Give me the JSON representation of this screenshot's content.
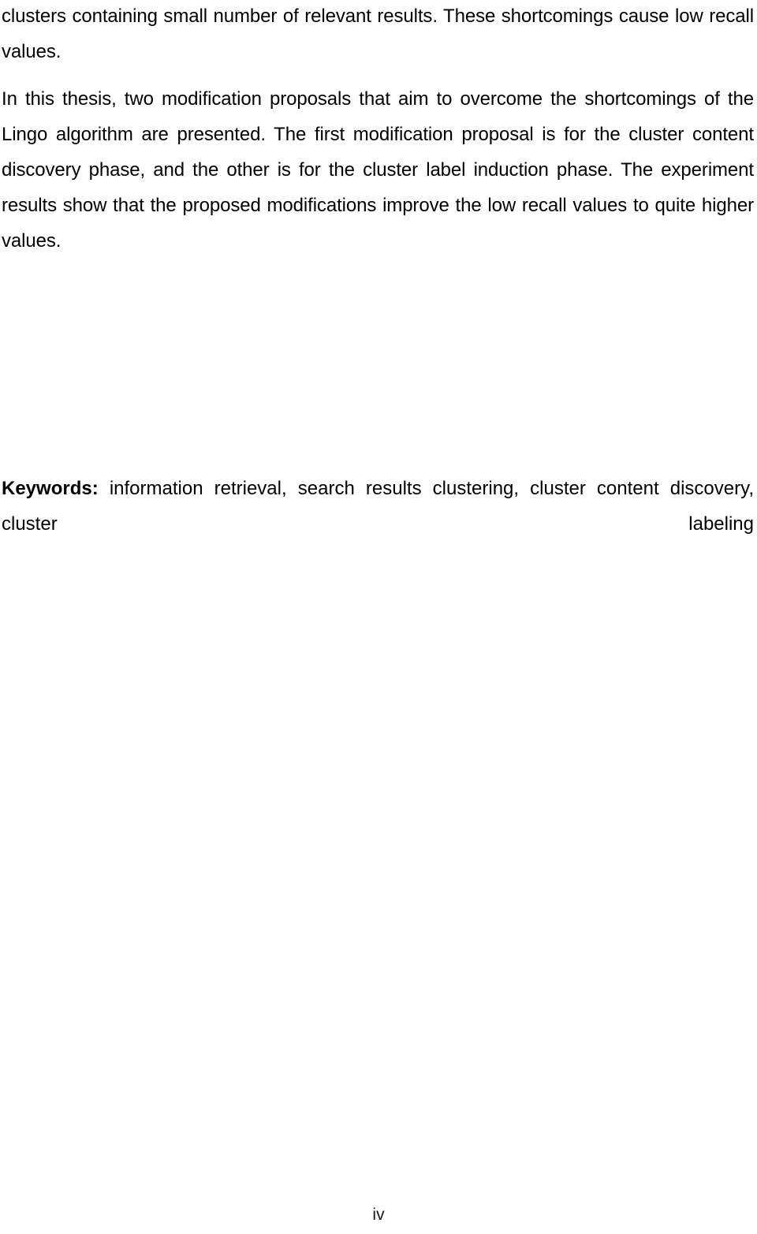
{
  "document": {
    "type": "thesis-abstract-page",
    "background_color": "#ffffff",
    "text_color": "#000000",
    "page_number": "iv"
  },
  "body": {
    "continuation_paragraph": "clusters containing small number of relevant results. These shortcomings cause low recall values.",
    "main_paragraph": "In this thesis, two modification proposals that aim to overcome the shortcomings of the Lingo algorithm are presented. The first modification proposal is for the cluster content discovery phase, and the other is for the cluster label induction phase. The experiment results show that the proposed modifications improve the low recall values to quite higher values."
  },
  "keywords": {
    "label": "Keywords:",
    "list": "information retrieval, search results clustering, cluster content discovery, cluster labeling"
  }
}
